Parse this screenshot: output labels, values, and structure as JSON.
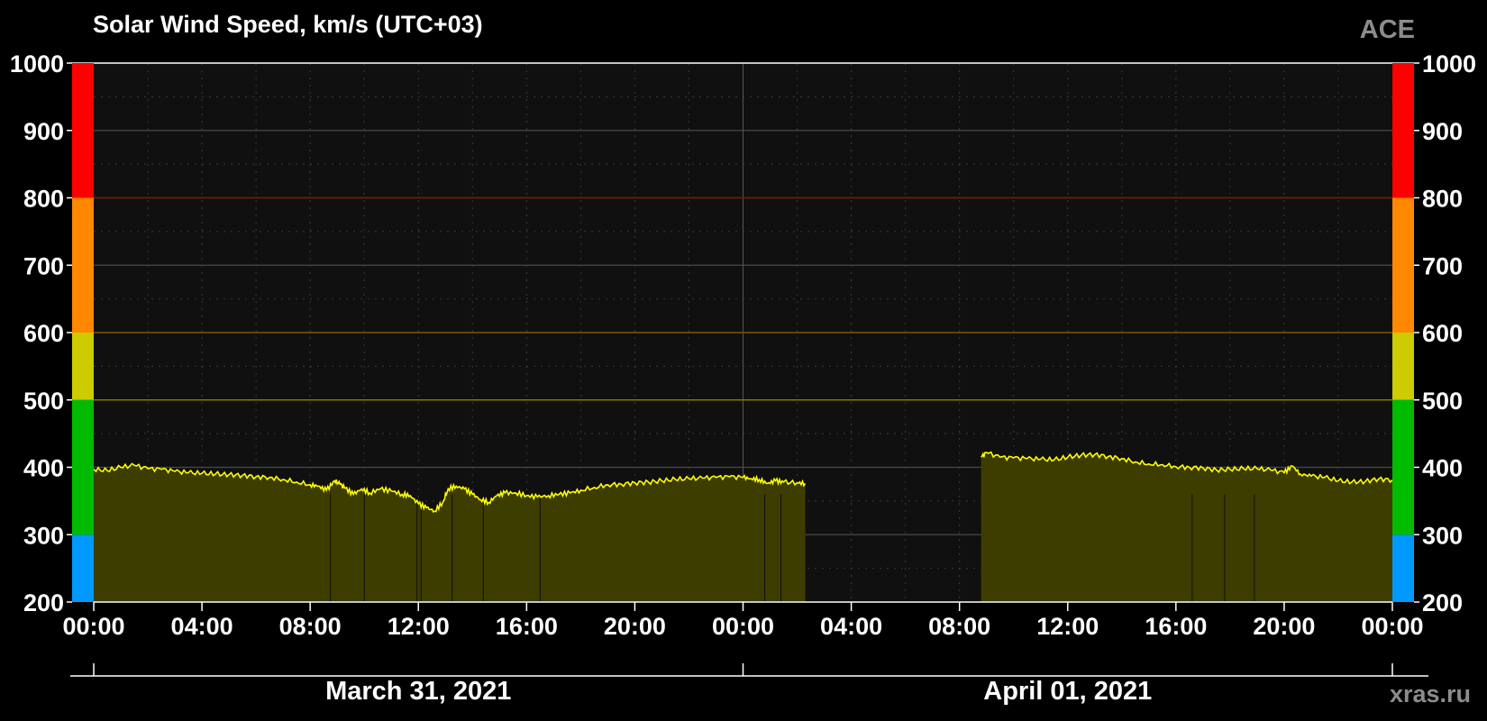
{
  "chart_data": {
    "type": "area",
    "title": "Solar Wind Speed, km/s (UTC+03)",
    "source_label": "ACE",
    "watermark": "xras.ru",
    "ylim": [
      200,
      1000
    ],
    "y_ticks": [
      200,
      300,
      400,
      500,
      600,
      700,
      800,
      900,
      1000
    ],
    "x_range_hours": [
      0,
      48
    ],
    "x_ticks": [
      {
        "hour": 0,
        "label": "00:00"
      },
      {
        "hour": 4,
        "label": "04:00"
      },
      {
        "hour": 8,
        "label": "08:00"
      },
      {
        "hour": 12,
        "label": "12:00"
      },
      {
        "hour": 16,
        "label": "16:00"
      },
      {
        "hour": 20,
        "label": "20:00"
      },
      {
        "hour": 24,
        "label": "00:00"
      },
      {
        "hour": 28,
        "label": "04:00"
      },
      {
        "hour": 32,
        "label": "08:00"
      },
      {
        "hour": 36,
        "label": "12:00"
      },
      {
        "hour": 40,
        "label": "16:00"
      },
      {
        "hour": 44,
        "label": "20:00"
      },
      {
        "hour": 48,
        "label": "00:00"
      }
    ],
    "dates": [
      {
        "label": "March 31, 2021",
        "center_hour": 12
      },
      {
        "label": "April 01, 2021",
        "center_hour": 36
      }
    ],
    "grid": true,
    "scale_bands": [
      {
        "from": 200,
        "to": 300,
        "color": "#0099ff"
      },
      {
        "from": 300,
        "to": 500,
        "color": "#00bb00"
      },
      {
        "from": 500,
        "to": 600,
        "color": "#cccc00"
      },
      {
        "from": 600,
        "to": 800,
        "color": "#ff8800"
      },
      {
        "from": 800,
        "to": 1000,
        "color": "#ff0000"
      }
    ],
    "threshold_lines": [
      {
        "value": 500,
        "color": "#7a7a00"
      },
      {
        "value": 600,
        "color": "#7a5000"
      },
      {
        "value": 800,
        "color": "#7a1a00"
      }
    ],
    "series": [
      {
        "color": "#ffff00",
        "fill": "#3d3d00",
        "segments": [
          [
            [
              0,
              397
            ],
            [
              0.5,
              395
            ],
            [
              1,
              400
            ],
            [
              1.5,
              403
            ],
            [
              2,
              398
            ],
            [
              2.5,
              397
            ],
            [
              3,
              394
            ],
            [
              3.5,
              392
            ],
            [
              4,
              391
            ],
            [
              4.5,
              390
            ],
            [
              5,
              389
            ],
            [
              5.5,
              388
            ],
            [
              6,
              386
            ],
            [
              6.5,
              385
            ],
            [
              7,
              382
            ],
            [
              7.5,
              378
            ],
            [
              8,
              374
            ],
            [
              8.3,
              372
            ],
            [
              8.6,
              366
            ],
            [
              8.9,
              380
            ],
            [
              9.1,
              375
            ],
            [
              9.3,
              369
            ],
            [
              9.6,
              360
            ],
            [
              9.9,
              368
            ],
            [
              10.2,
              362
            ],
            [
              10.6,
              368
            ],
            [
              11,
              365
            ],
            [
              11.4,
              360
            ],
            [
              11.7,
              358
            ],
            [
              12,
              346
            ],
            [
              12.3,
              340
            ],
            [
              12.6,
              335
            ],
            [
              12.9,
              348
            ],
            [
              13.1,
              368
            ],
            [
              13.4,
              372
            ],
            [
              13.7,
              368
            ],
            [
              14,
              360
            ],
            [
              14.3,
              352
            ],
            [
              14.6,
              348
            ],
            [
              14.9,
              358
            ],
            [
              15.2,
              362
            ],
            [
              15.6,
              362
            ],
            [
              16,
              358
            ],
            [
              16.4,
              356
            ],
            [
              16.8,
              358
            ],
            [
              17.2,
              360
            ],
            [
              17.6,
              362
            ],
            [
              18,
              366
            ],
            [
              18.5,
              370
            ],
            [
              19,
              374
            ],
            [
              19.5,
              375
            ],
            [
              20,
              377
            ],
            [
              20.5,
              378
            ],
            [
              21,
              380
            ],
            [
              21.5,
              382
            ],
            [
              22,
              383
            ],
            [
              22.5,
              384
            ],
            [
              23,
              385
            ],
            [
              23.5,
              386
            ],
            [
              24,
              385
            ],
            [
              24.3,
              383
            ],
            [
              24.6,
              382
            ],
            [
              24.9,
              376
            ],
            [
              25.2,
              380
            ],
            [
              25.5,
              378
            ],
            [
              26,
              377
            ],
            [
              26.3,
              376
            ]
          ],
          [
            [
              32.8,
              415
            ],
            [
              33,
              422
            ],
            [
              33.5,
              415
            ],
            [
              34,
              414
            ],
            [
              34.5,
              413
            ],
            [
              35,
              412
            ],
            [
              35.5,
              411
            ],
            [
              36,
              415
            ],
            [
              36.5,
              418
            ],
            [
              37,
              419
            ],
            [
              37.5,
              416
            ],
            [
              38,
              413
            ],
            [
              38.5,
              408
            ],
            [
              39,
              405
            ],
            [
              39.5,
              404
            ],
            [
              40,
              401
            ],
            [
              40.5,
              400
            ],
            [
              41,
              399
            ],
            [
              41.5,
              396
            ],
            [
              42,
              397
            ],
            [
              42.5,
              398
            ],
            [
              43,
              398
            ],
            [
              43.5,
              396
            ],
            [
              44,
              392
            ],
            [
              44.3,
              402
            ],
            [
              44.6,
              390
            ],
            [
              45,
              387
            ],
            [
              45.5,
              385
            ],
            [
              46,
              380
            ],
            [
              46.5,
              378
            ],
            [
              47,
              379
            ],
            [
              47.5,
              383
            ],
            [
              48,
              381
            ]
          ]
        ]
      }
    ]
  }
}
